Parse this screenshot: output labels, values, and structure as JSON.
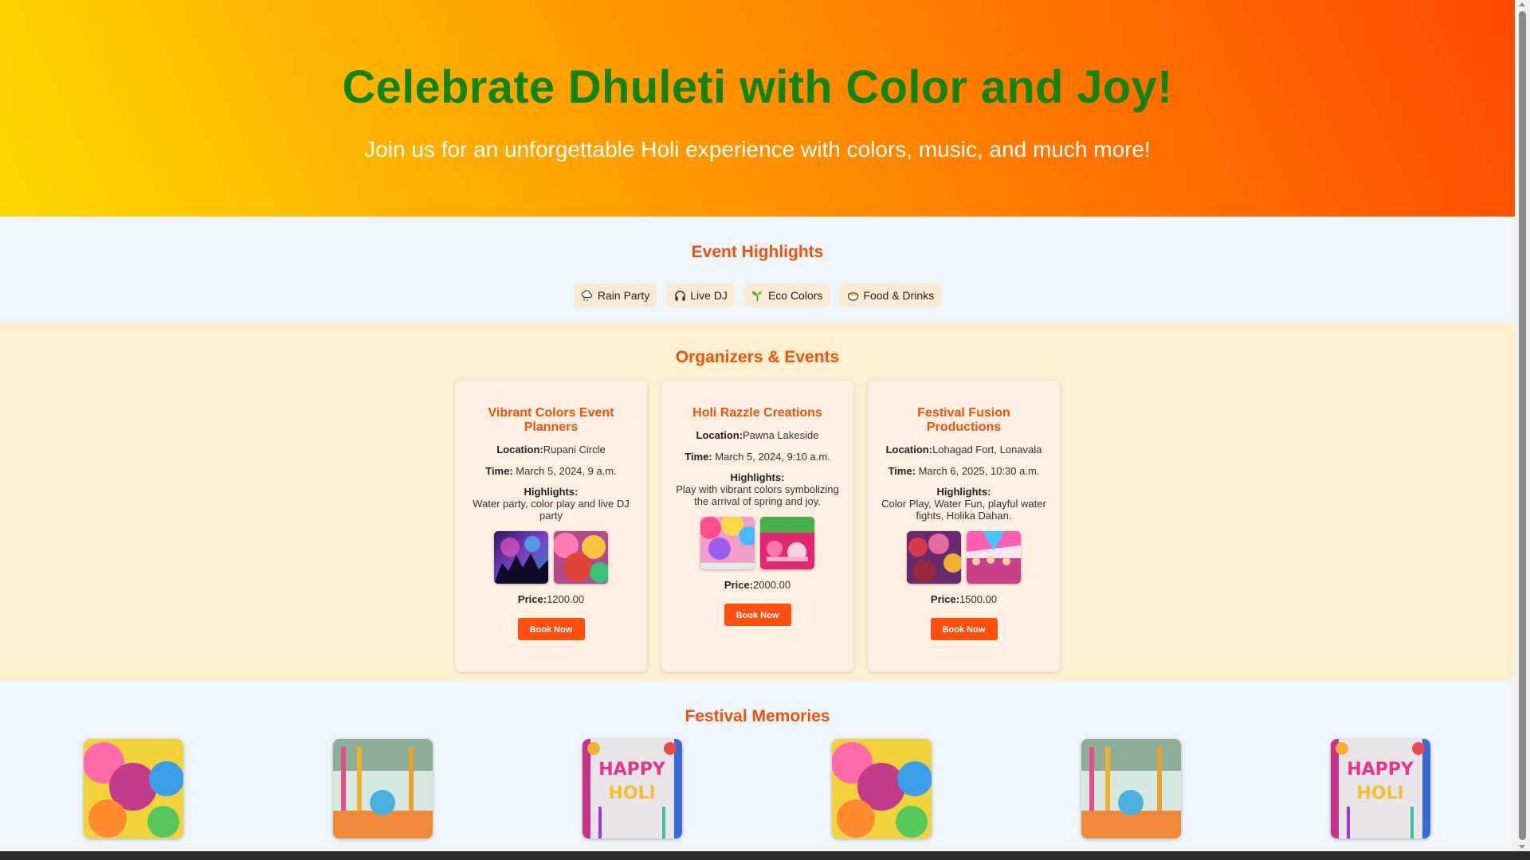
{
  "hero": {
    "title": "Celebrate Dhuleti with Color and Joy!",
    "subtitle": "Join us for an unforgettable Holi experience with colors, music, and much more!"
  },
  "highlights": {
    "title": "Event Highlights",
    "items": [
      {
        "label": "Rain Party",
        "icon": "rain-cloud-icon"
      },
      {
        "label": "Live DJ",
        "icon": "headphones-icon"
      },
      {
        "label": "Eco Colors",
        "icon": "seedling-icon"
      },
      {
        "label": "Food & Drinks",
        "icon": "food-bowl-icon"
      }
    ]
  },
  "organizers": {
    "title": "Organizers & Events",
    "location_label": "Location:",
    "time_label": "Time:",
    "highlights_label": "Highlights:",
    "price_label": "Price:",
    "book_label": "Book Now",
    "cards": [
      {
        "name": "Vibrant Colors Event Planners",
        "location": "Rupani Circle",
        "time": "March 5, 2024, 9 a.m.",
        "highlights": "Water party, color play and live DJ party",
        "price": "1200.00"
      },
      {
        "name": "Holi Razzle Creations",
        "location": "Pawna Lakeside",
        "time": "March 5, 2024, 9:10 a.m.",
        "highlights": "Play with vibrant colors symbolizing the arrival of spring and joy.",
        "price": "2000.00"
      },
      {
        "name": "Festival Fusion Productions",
        "location": "Lohagad Fort, Lonavala",
        "time": "March 6, 2025, 10:30 a.m.",
        "highlights": "Color Play, Water Fun, playful water fights, Holika Dahan.",
        "price": "1500.00"
      }
    ]
  },
  "memories": {
    "title": "Festival Memories"
  },
  "colors": {
    "accent": "#f0520a",
    "hero_title": "#128412",
    "button": "#ff4f0f"
  }
}
